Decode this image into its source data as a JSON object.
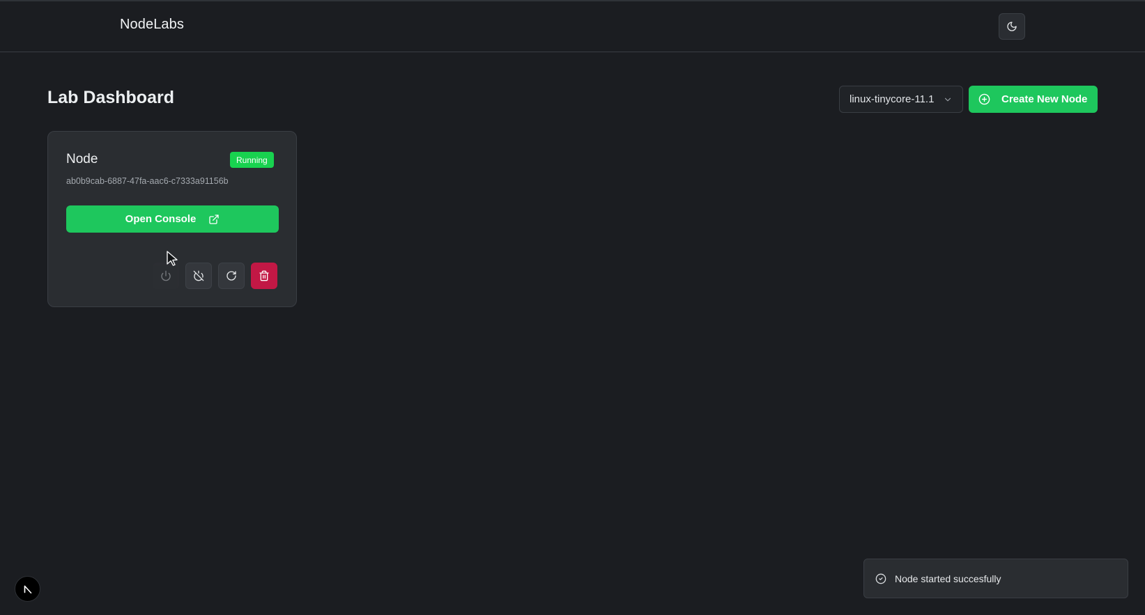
{
  "header": {
    "brand": "NodeLabs",
    "theme_toggle_icon": "moon-icon"
  },
  "dashboard": {
    "title": "Lab Dashboard",
    "image_select": {
      "selected": "linux-tinycore-11.1",
      "icon": "chevron-down-icon"
    },
    "create_button": {
      "label": "Create New Node",
      "icon": "plus-circle-icon"
    }
  },
  "nodes": [
    {
      "name": "Node",
      "status": "Running",
      "id": "ab0b9cab-6887-47fa-aac6-c7333a91156b",
      "console_label": "Open Console",
      "console_icon": "external-link-icon",
      "actions": [
        {
          "name": "start",
          "icon": "power-icon",
          "enabled": false
        },
        {
          "name": "stop",
          "icon": "power-off-icon",
          "enabled": true
        },
        {
          "name": "restart",
          "icon": "refresh-icon",
          "enabled": true
        },
        {
          "name": "delete",
          "icon": "trash-icon",
          "enabled": true
        }
      ]
    }
  ],
  "toast": {
    "message": "Node started succesfully",
    "icon": "check-circle-icon"
  },
  "colors": {
    "background": "#1b1d21",
    "card": "#2a2d31",
    "accent_green": "#1ec75d",
    "badge_green": "#18d24f",
    "danger": "#c21845"
  }
}
